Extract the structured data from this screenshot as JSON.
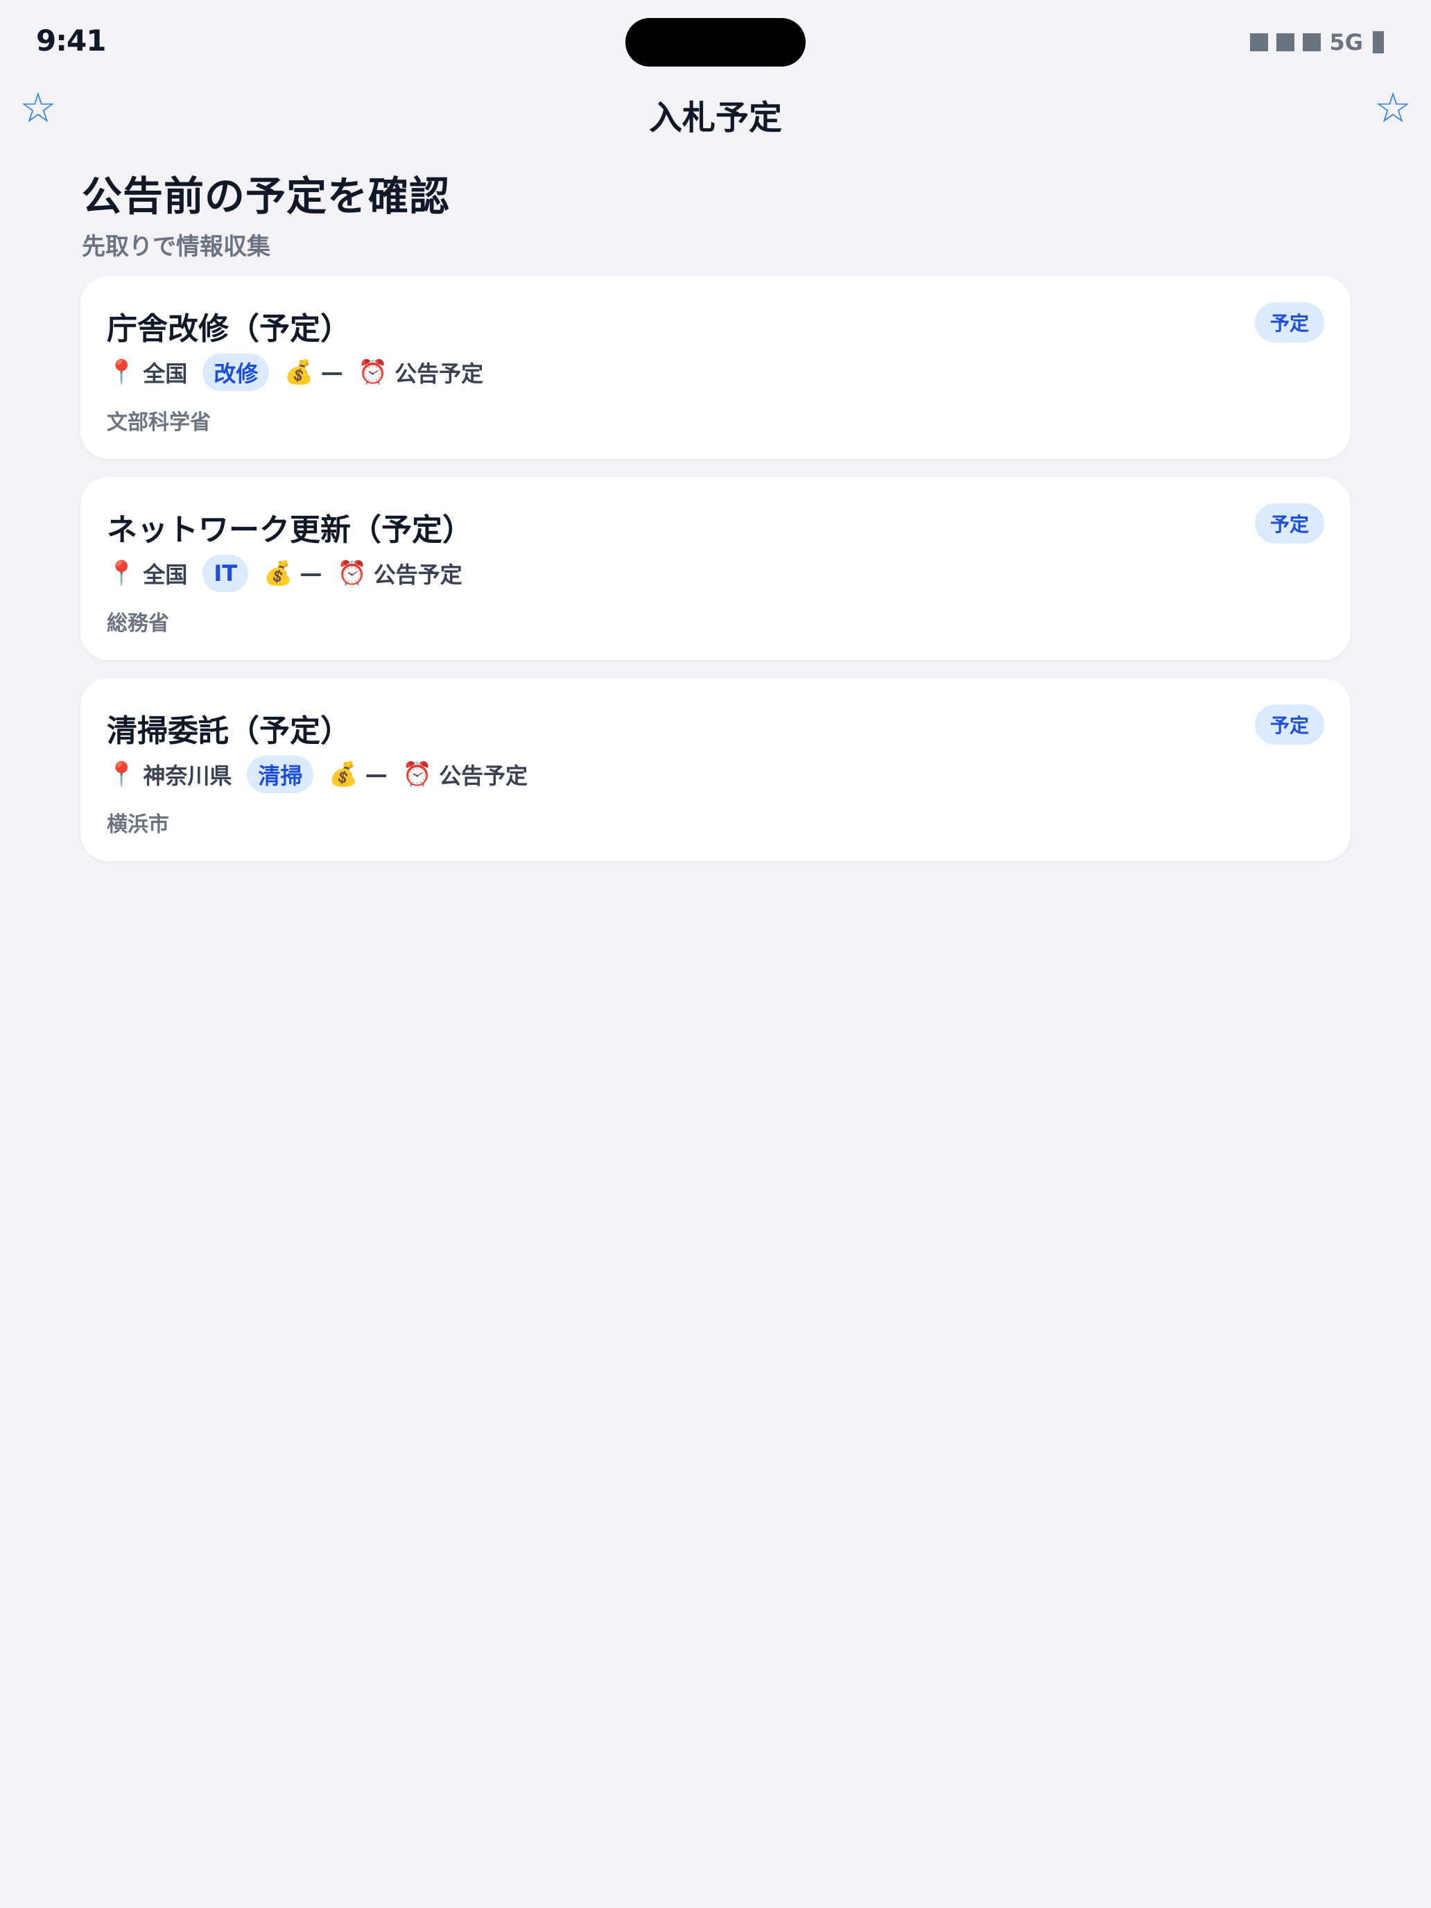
{
  "status_bar": {
    "time": "9:41",
    "network": "5G"
  },
  "nav": {
    "title": "入札予定",
    "left_icon": "star-outline-icon",
    "right_icon": "star-outline-icon",
    "star_glyph": "☆"
  },
  "header": {
    "title": "公告前の予定を確認",
    "subtitle": "先取りで情報収集"
  },
  "icons": {
    "location": "📍",
    "money": "💰",
    "clock": "⏰"
  },
  "cards": [
    {
      "title": "庁舎改修（予定）",
      "badge": "予定",
      "location": "全国",
      "category": "改修",
      "budget": "—",
      "notice": "公告予定",
      "agency": "文部科学省"
    },
    {
      "title": "ネットワーク更新（予定）",
      "badge": "予定",
      "location": "全国",
      "category": "IT",
      "budget": "—",
      "notice": "公告予定",
      "agency": "総務省"
    },
    {
      "title": "清掃委託（予定）",
      "badge": "予定",
      "location": "神奈川県",
      "category": "清掃",
      "budget": "—",
      "notice": "公告予定",
      "agency": "横浜市"
    }
  ],
  "colors": {
    "background": "#f2f2f7",
    "accent": "#2f80ed",
    "badge_bg": "#dbeafe",
    "badge_text": "#1d4ed8"
  }
}
